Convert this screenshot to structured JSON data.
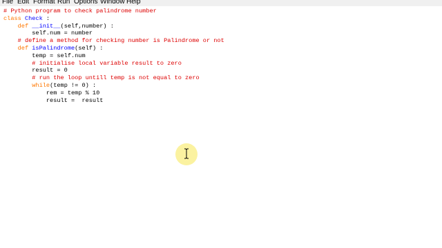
{
  "menu": [
    "File",
    "Edit",
    "Format",
    "Run",
    "Options",
    "Window",
    "Help"
  ],
  "code_lines": [
    [
      {
        "t": "# Python program to check palindrome number",
        "c": "comment"
      }
    ],
    [
      {
        "t": "class ",
        "c": "keyword"
      },
      {
        "t": "Check",
        "c": "def"
      },
      {
        "t": " :",
        "c": "normal"
      }
    ],
    [
      {
        "t": "    def ",
        "c": "keyword"
      },
      {
        "t": "__init__",
        "c": "def"
      },
      {
        "t": "(self,number) :",
        "c": "normal"
      }
    ],
    [
      {
        "t": "        self.num = number",
        "c": "normal"
      }
    ],
    [
      {
        "t": "    # define a method for checking number is Palindrome or not",
        "c": "comment"
      }
    ],
    [
      {
        "t": "    def ",
        "c": "keyword"
      },
      {
        "t": "isPalindrome",
        "c": "def"
      },
      {
        "t": "(self) :",
        "c": "normal"
      }
    ],
    [
      {
        "t": "        temp = self.num",
        "c": "normal"
      }
    ],
    [
      {
        "t": "        # initialise local variable result to zero",
        "c": "comment"
      }
    ],
    [
      {
        "t": "        result = 0",
        "c": "normal"
      }
    ],
    [
      {
        "t": "        # run the loop untill temp is not equal to zero",
        "c": "comment"
      }
    ],
    [
      {
        "t": "        ",
        "c": "normal"
      },
      {
        "t": "while",
        "c": "keyword"
      },
      {
        "t": "(temp != 0) :",
        "c": "normal"
      }
    ],
    [
      {
        "t": "            rem = temp % 10",
        "c": "normal"
      }
    ],
    [
      {
        "t": "            result =  result",
        "c": "normal"
      }
    ]
  ],
  "colors": {
    "comment": "#dd0000",
    "keyword": "#ff7700",
    "def": "#0000ff",
    "normal": "#000000",
    "cursor_highlight": "#fbf2a0"
  },
  "icons": {
    "text_cursor": "i-beam-cursor-icon"
  }
}
